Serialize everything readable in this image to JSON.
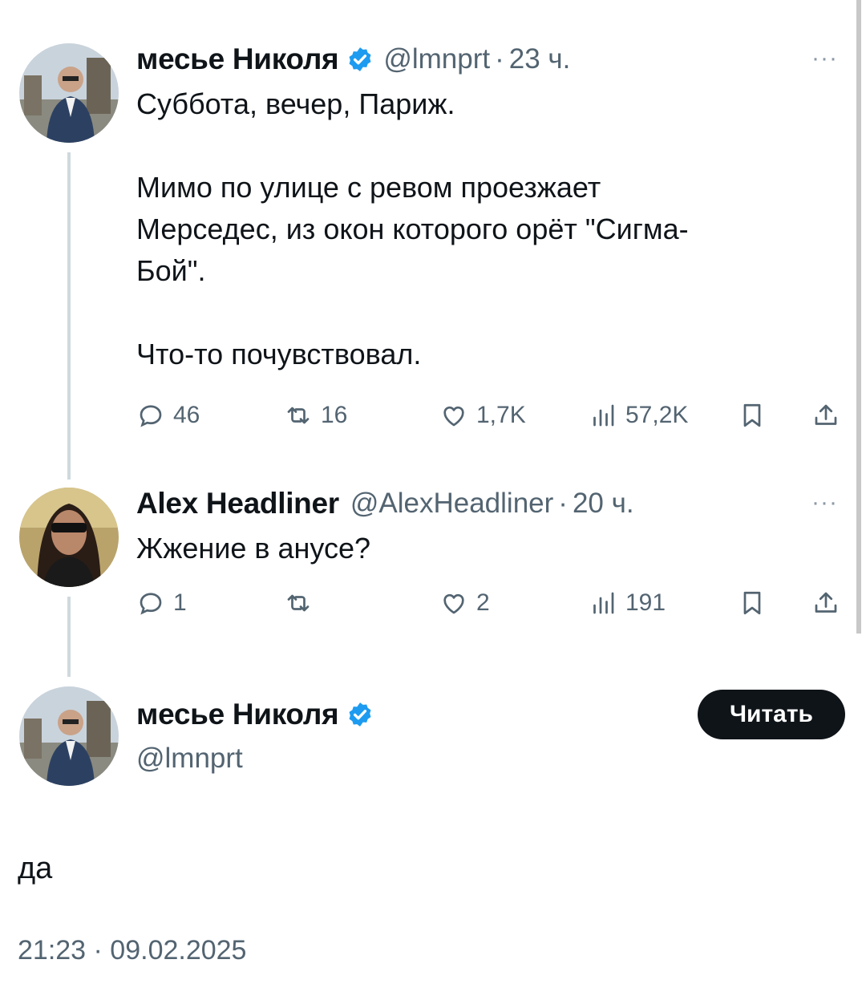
{
  "tweet1": {
    "name": "месье Николя",
    "handle": "@lmnprt",
    "time": "23 ч.",
    "text": "Суббота, вечер, Париж.\n\nМимо по улице с ревом проезжает\nМерседес, из окон которого орёт \"Сигма-\nБой\".\n\nЧто-то почувствовал.",
    "replies": "46",
    "reposts": "16",
    "likes": "1,7K",
    "views": "57,2K"
  },
  "tweet2": {
    "name": "Alex Headliner",
    "handle": "@AlexHeadliner",
    "time": "20 ч.",
    "text": "Жжение в анусе?",
    "replies": "1",
    "reposts": "",
    "likes": "2",
    "views": "191"
  },
  "tweet3": {
    "name": "месье Николя",
    "handle": "@lmnprt",
    "follow_label": "Читать",
    "text": "да",
    "timestamp": "21:23 · 09.02.2025"
  },
  "separator": "·",
  "more": "···",
  "colors": {
    "verified": "#1d9bf0",
    "muted": "#536471",
    "thread_line": "#cfd9de"
  },
  "icons": [
    "verified-badge-icon",
    "reply-icon",
    "repost-icon",
    "like-icon",
    "views-icon",
    "bookmark-icon",
    "share-icon",
    "more-icon"
  ]
}
